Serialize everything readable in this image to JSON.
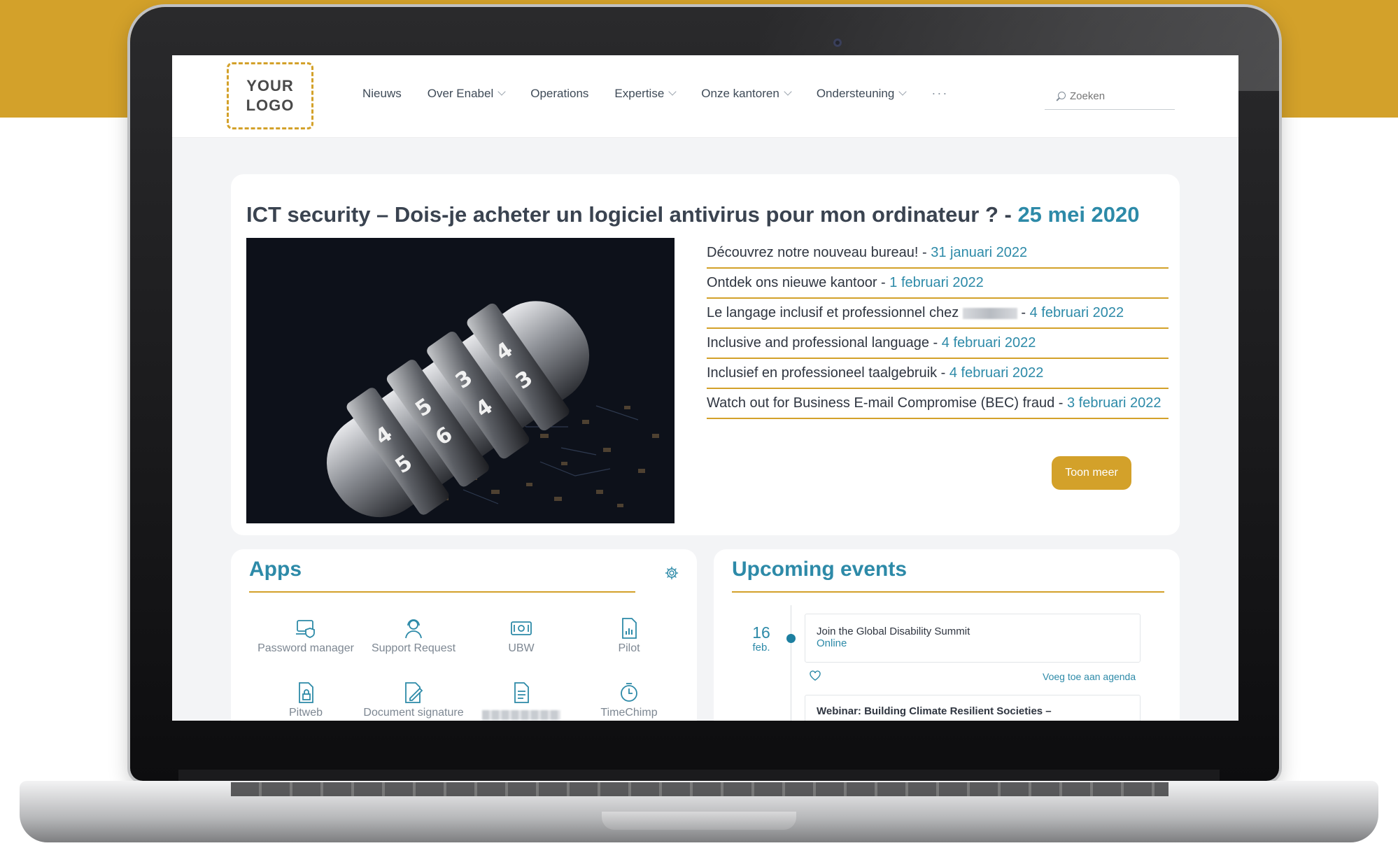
{
  "logo": {
    "text": "YOUR\nLOGO"
  },
  "nav": {
    "items": [
      {
        "label": "Nieuws",
        "has_dropdown": false
      },
      {
        "label": "Over Enabel",
        "has_dropdown": true
      },
      {
        "label": "Operations",
        "has_dropdown": false
      },
      {
        "label": "Expertise",
        "has_dropdown": true
      },
      {
        "label": "Onze kantoren",
        "has_dropdown": true
      },
      {
        "label": "Ondersteuning",
        "has_dropdown": true
      }
    ],
    "more": "···"
  },
  "search": {
    "placeholder": "Zoeken",
    "icon": "search-icon"
  },
  "featured": {
    "title": "ICT security – Dois-je acheter un logiciel antivirus pour mon ordinateur ? -",
    "date": "25 mei 2020"
  },
  "news": [
    {
      "title": "Découvrez notre nouveau bureau! - ",
      "date": "31 januari 2022"
    },
    {
      "title": "Ontdek ons nieuwe kantoor - ",
      "date": "1 februari 2022"
    },
    {
      "title": "Le langage inclusif et professionnel chez",
      "title_after": " - ",
      "date": "4 februari 2022"
    },
    {
      "title": "Inclusive and professional language - ",
      "date": "4 februari 2022"
    },
    {
      "title": "Inclusief en professioneel taalgebruik - ",
      "date": "4 februari 2022"
    },
    {
      "title": "Watch out for Business E-mail Compromise (BEC) fraud - ",
      "date": "3 februari 2022"
    }
  ],
  "show_more_label": "Toon meer",
  "apps": {
    "title": "Apps",
    "settings_icon": "gear-icon",
    "items": [
      {
        "label": "Password manager",
        "icon": "password-manager-icon"
      },
      {
        "label": "Support Request",
        "icon": "support-agent-icon"
      },
      {
        "label": "UBW",
        "icon": "cash-icon"
      },
      {
        "label": "Pilot",
        "icon": "report-chart-icon"
      },
      {
        "label": "Pitweb",
        "icon": "locked-document-icon"
      },
      {
        "label": "Document signature",
        "icon": "document-sign-icon"
      },
      {
        "label": "",
        "icon": "document-icon"
      },
      {
        "label": "TimeChimp",
        "icon": "clock-icon"
      }
    ]
  },
  "events": {
    "title": "Upcoming events",
    "items": [
      {
        "day": "16",
        "month": "feb.",
        "title": "Join the Global Disability Summit",
        "location": "Online",
        "agenda_label": "Voeg toe aan agenda"
      },
      {
        "title": "Webinar: Building Climate Resilient Societies –"
      }
    ]
  },
  "colors": {
    "accent_gold": "#d3a12a",
    "link_teal": "#2d8aa8",
    "text_dark": "#2f3540"
  }
}
